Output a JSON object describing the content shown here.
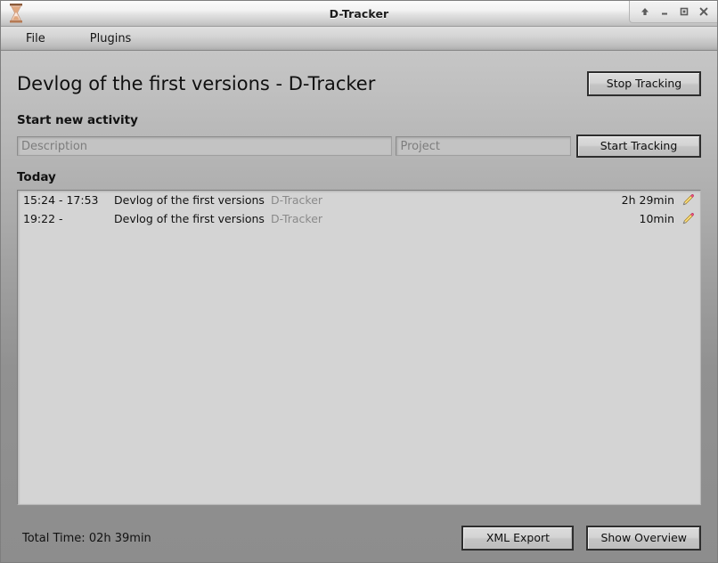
{
  "window": {
    "title": "D-Tracker",
    "icon": "hourglass-icon",
    "controls": [
      {
        "name": "shade-button",
        "glyph": "up-arrow-icon"
      },
      {
        "name": "minimize-button",
        "glyph": "minimize-icon"
      },
      {
        "name": "maximize-button",
        "glyph": "maximize-icon"
      },
      {
        "name": "close-button",
        "glyph": "close-icon"
      }
    ]
  },
  "menubar": {
    "items": [
      {
        "label": "File"
      },
      {
        "label": "Plugins"
      }
    ]
  },
  "main": {
    "page_title": "Devlog of the first versions - D-Tracker",
    "stop_tracking_label": "Stop Tracking",
    "new_activity_label": "Start new activity",
    "start_tracking_label": "Start Tracking",
    "description_value": "",
    "description_placeholder": "Description",
    "project_value": "",
    "project_placeholder": "Project",
    "today_label": "Today"
  },
  "activities": [
    {
      "time": "15:24 - 17:53",
      "description": "Devlog of the first versions",
      "project": "D-Tracker",
      "duration": "2h 29min",
      "edit_icon": "pencil-icon"
    },
    {
      "time": "19:22 -",
      "description": "Devlog of the first versions",
      "project": "D-Tracker",
      "duration": "10min",
      "edit_icon": "pencil-icon"
    }
  ],
  "footer": {
    "total_time": "Total Time: 02h 39min",
    "xml_export_label": "XML Export",
    "show_overview_label": "Show Overview"
  },
  "colors": {
    "window_bg": "#8d8d8d",
    "list_bg": "#d4d4d4",
    "project_text": "#8a8a8a",
    "pencil_body": "#f0c040",
    "pencil_eraser": "#e8527a"
  }
}
